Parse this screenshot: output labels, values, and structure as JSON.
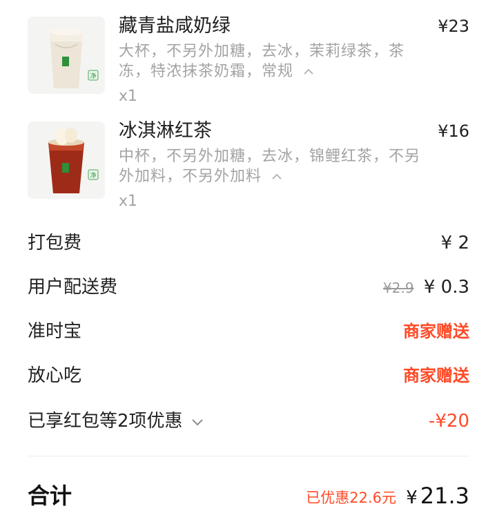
{
  "items": [
    {
      "name": "藏青盐咸奶绿",
      "price": "¥23",
      "spec_line1": "大杯，不另外加糖，去冰，茉莉绿茶，茶",
      "spec_line2": "冻，特浓抹茶奶霜，常规",
      "qty": "x1",
      "image": "milk-tea-cup-icon"
    },
    {
      "name": "冰淇淋红茶",
      "price": "¥16",
      "spec_line1": "中杯，不另外加糖，去冰，锦鲤红茶，不另",
      "spec_line2": "外加料，不另外加料",
      "qty": "x1",
      "image": "black-tea-cup-icon"
    }
  ],
  "fees": {
    "packing": {
      "label": "打包费",
      "value": "¥ 2"
    },
    "delivery": {
      "label": "用户配送费",
      "original": "¥2.9",
      "value": "¥ 0.3"
    },
    "ontime": {
      "label": "准时宝",
      "value": "商家赠送"
    },
    "safe": {
      "label": "放心吃",
      "value": "商家赠送"
    },
    "discount": {
      "label": "已享红包等2项优惠",
      "value": "-¥20"
    }
  },
  "total": {
    "label": "合计",
    "saved": "已优惠22.6元",
    "currency": "¥",
    "amount": "21.3"
  },
  "colors": {
    "accent_red": "#ff4a26",
    "muted_text": "#a3a3a3"
  }
}
